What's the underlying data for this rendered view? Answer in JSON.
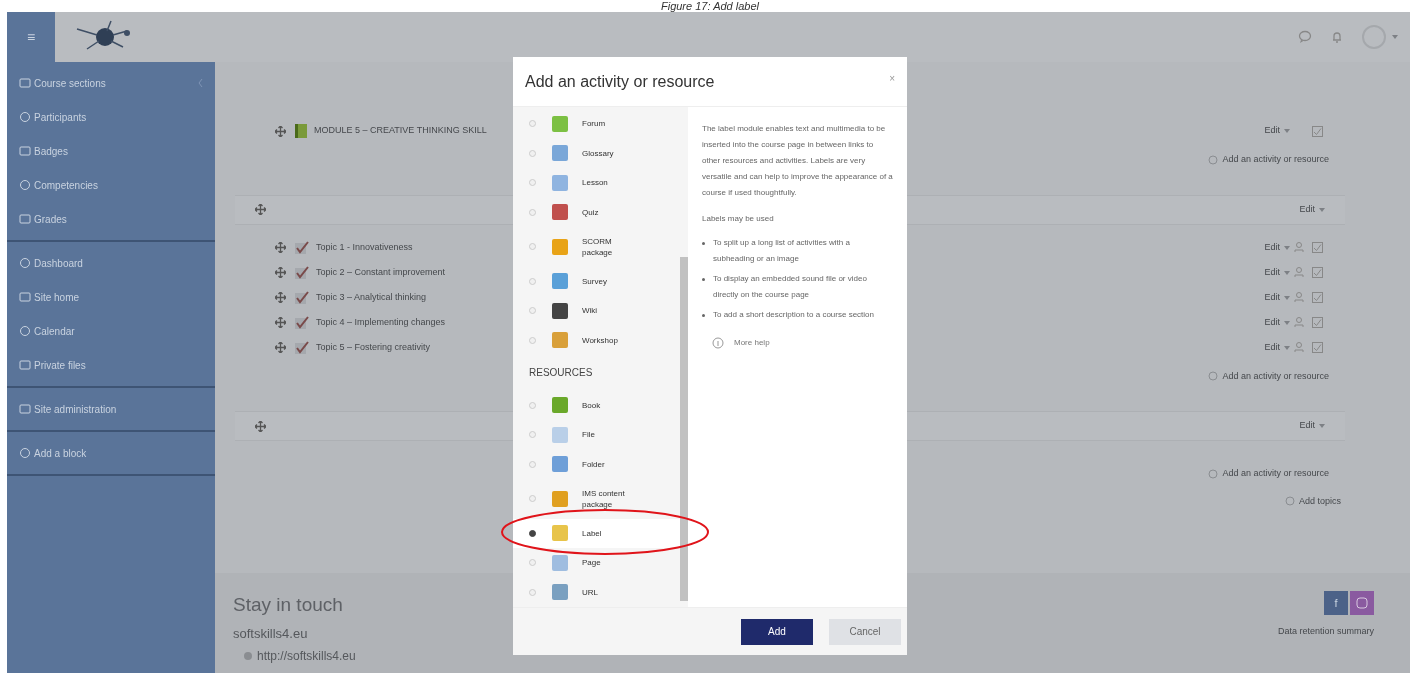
{
  "caption": "Figure 17: Add label",
  "topbar": {
    "menu_icon": "≡"
  },
  "sidebar": {
    "groups": [
      [
        {
          "label": "Course sections",
          "expandable": true
        },
        {
          "label": "Participants",
          "expandable": false
        },
        {
          "label": "Badges",
          "expandable": false
        },
        {
          "label": "Competencies",
          "expandable": false
        },
        {
          "label": "Grades",
          "expandable": false
        }
      ],
      [
        {
          "label": "Dashboard",
          "expandable": false
        },
        {
          "label": "Site home",
          "expandable": false
        },
        {
          "label": "Calendar",
          "expandable": false
        },
        {
          "label": "Private files",
          "expandable": false
        }
      ],
      [
        {
          "label": "Site administration",
          "expandable": false
        }
      ],
      [
        {
          "label": "Add a block",
          "expandable": false
        }
      ]
    ]
  },
  "course": {
    "sections": [
      {
        "activities": [
          {
            "kind": "book",
            "title": "MODULE 5 – CREATIVE THINKING SKILL",
            "edit": "Edit"
          }
        ],
        "add_link": "Add an activity or resource"
      },
      {
        "header_edit": "Edit",
        "activities": [
          {
            "kind": "quiz",
            "title": "Topic 1 - Innovativeness",
            "edit": "Edit"
          },
          {
            "kind": "quiz",
            "title": "Topic 2 – Constant improvement",
            "edit": "Edit"
          },
          {
            "kind": "quiz",
            "title": "Topic 3 – Analytical thinking",
            "edit": "Edit"
          },
          {
            "kind": "quiz",
            "title": "Topic 4 – Implementing changes",
            "edit": "Edit"
          },
          {
            "kind": "quiz",
            "title": "Topic 5 – Fostering creativity",
            "edit": "Edit"
          }
        ],
        "add_link": "Add an activity or resource"
      },
      {
        "header_edit": "Edit",
        "add_link": "Add an activity or resource"
      }
    ],
    "add_topics": "Add topics"
  },
  "footer": {
    "title": "Stay in touch",
    "site": "softskills4.eu",
    "url": "http://softskills4.eu",
    "facebook": "f",
    "data_retention": "Data retention summary"
  },
  "modal": {
    "title": "Add an activity or resource",
    "close": "×",
    "items": [
      {
        "kind": "item",
        "label": "Forum",
        "selected": false
      },
      {
        "kind": "item",
        "label": "Glossary",
        "selected": false
      },
      {
        "kind": "item",
        "label": "Lesson",
        "selected": false
      },
      {
        "kind": "item",
        "label": "Quiz",
        "selected": false
      },
      {
        "kind": "item",
        "label": "SCORM package",
        "selected": false
      },
      {
        "kind": "item",
        "label": "Survey",
        "selected": false
      },
      {
        "kind": "item",
        "label": "Wiki",
        "selected": false
      },
      {
        "kind": "item",
        "label": "Workshop",
        "selected": false
      },
      {
        "kind": "heading",
        "label": "RESOURCES"
      },
      {
        "kind": "item",
        "label": "Book",
        "selected": false
      },
      {
        "kind": "item",
        "label": "File",
        "selected": false
      },
      {
        "kind": "item",
        "label": "Folder",
        "selected": false
      },
      {
        "kind": "item",
        "label": "IMS content package",
        "selected": false
      },
      {
        "kind": "item",
        "label": "Label",
        "selected": true
      },
      {
        "kind": "item",
        "label": "Page",
        "selected": false
      },
      {
        "kind": "item",
        "label": "URL",
        "selected": false
      }
    ],
    "description": "The label module enables text and multimedia to be inserted into the course page in between links to other resources and activities. Labels are very versatile and can help to improve the appearance of a course if used thoughtfully.",
    "uses_title": "Labels may be used",
    "uses": [
      "To split up a long list of activities with a subheading or an image",
      "To display an embedded sound file or video directly on the course page",
      "To add a short description to a course section"
    ],
    "more_help": "More help",
    "buttons": [
      {
        "kind": "primary",
        "label": "Add"
      },
      {
        "kind": "secondary",
        "label": "Cancel"
      }
    ]
  }
}
